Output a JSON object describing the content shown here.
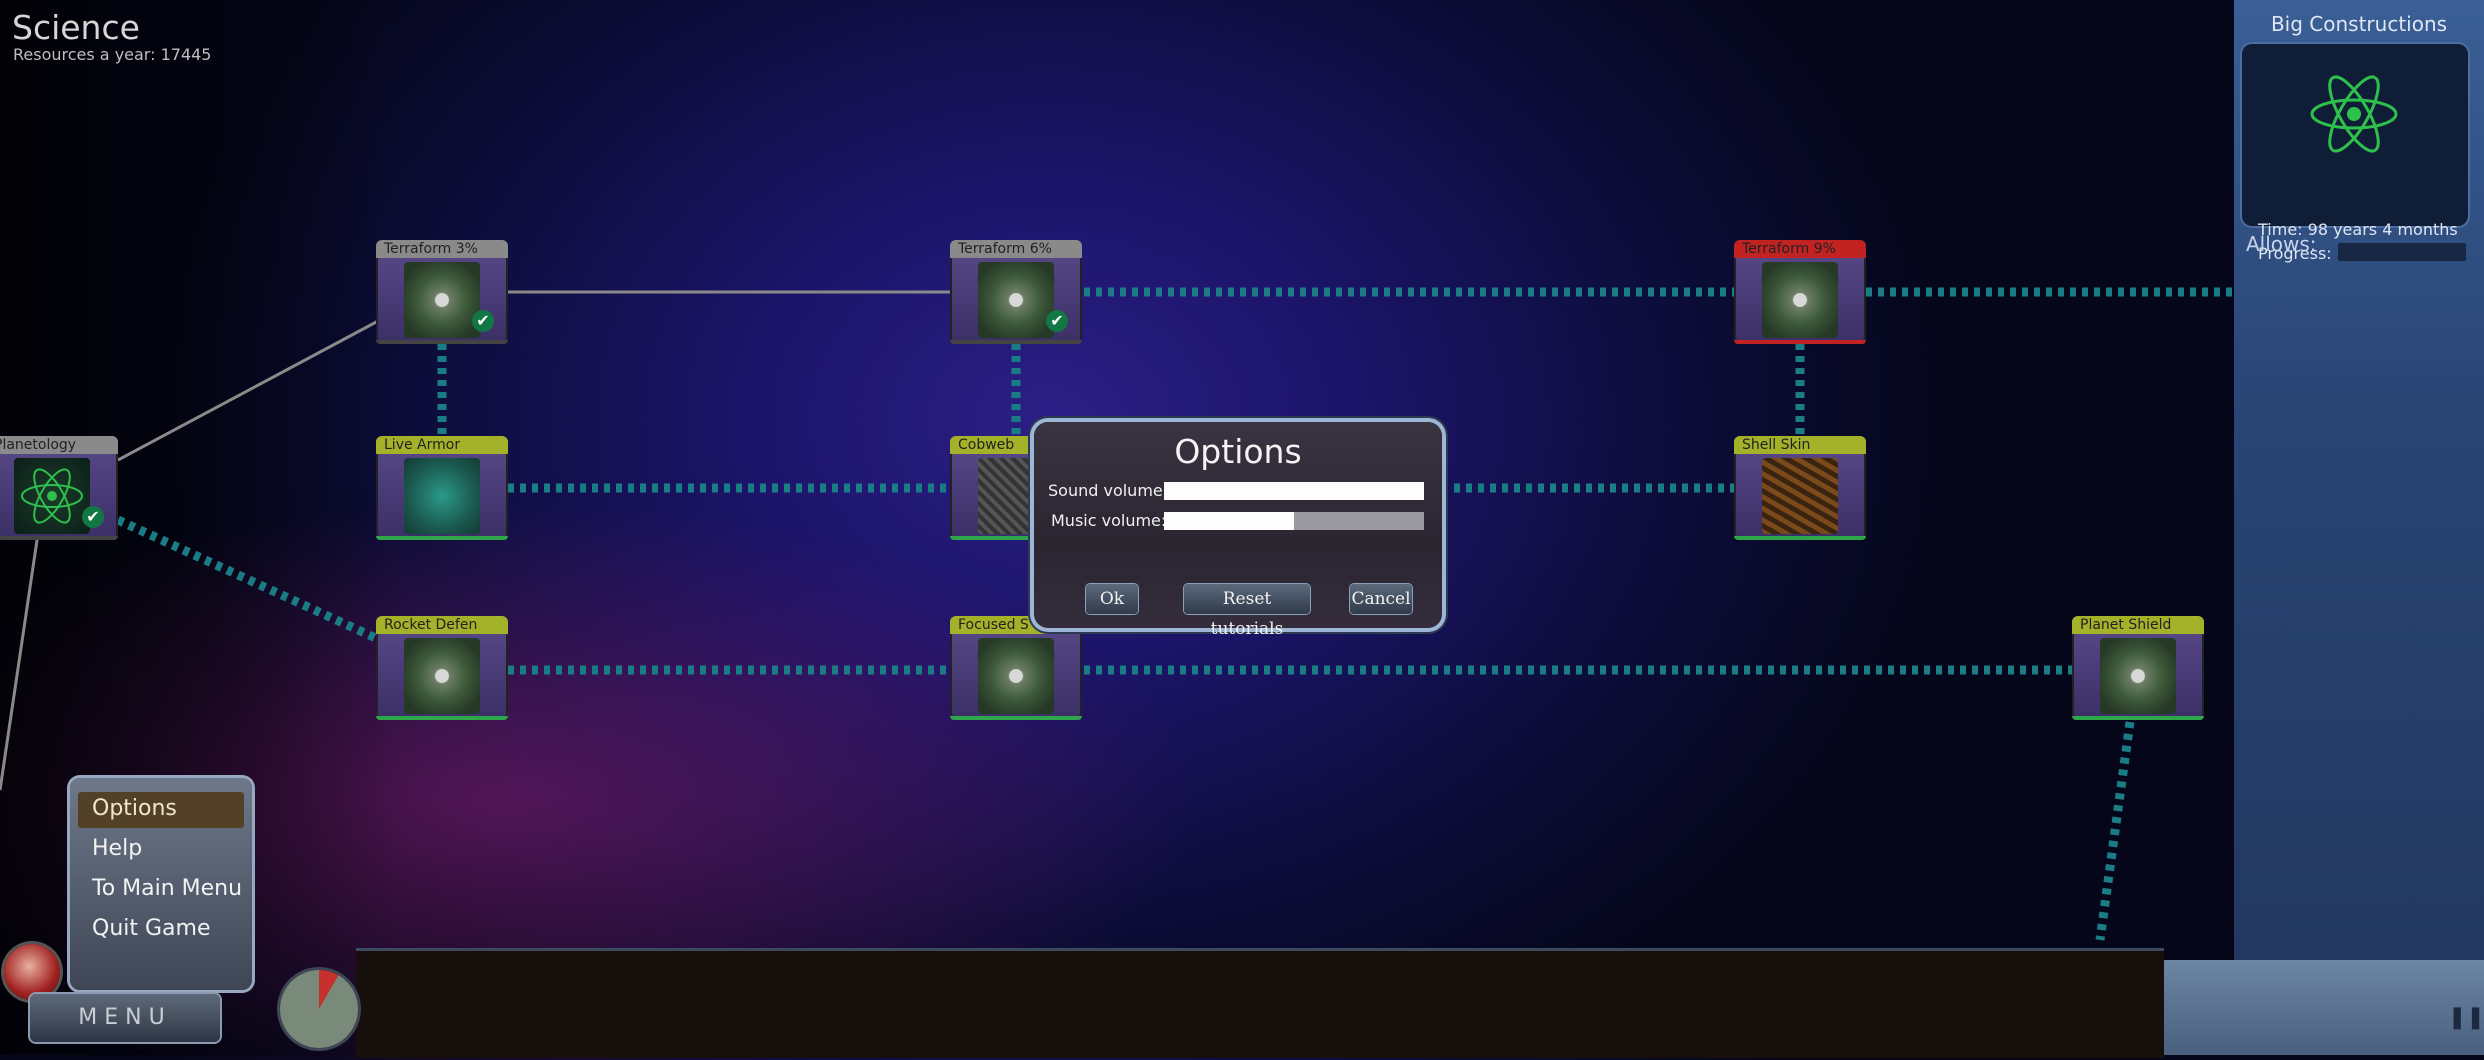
{
  "header": {
    "title": "Science",
    "resources": "Resources a year: 17445"
  },
  "nodes": [
    {
      "id": "terraform-3",
      "label": "Terraform 3%",
      "researched": true,
      "header_color": "#8a8a8a"
    },
    {
      "id": "terraform-6",
      "label": "Terraform 6%",
      "researched": true,
      "header_color": "#8a8a8a"
    },
    {
      "id": "terraform-9",
      "label": "Terraform 9%",
      "researched": false,
      "header_color": "#c22222"
    },
    {
      "id": "planetology",
      "label": "Planetology",
      "researched": true,
      "header_color": "#8a8a8a"
    },
    {
      "id": "live-armor",
      "label": "Live Armor",
      "researched": false,
      "header_color": "#a4b22a"
    },
    {
      "id": "cobweb",
      "label": "Cobweb",
      "researched": false,
      "header_color": "#a4b22a"
    },
    {
      "id": "shell-skin",
      "label": "Shell Skin",
      "researched": false,
      "header_color": "#a4b22a"
    },
    {
      "id": "rocket-defen",
      "label": "Rocket Defen",
      "researched": false,
      "header_color": "#a4b22a"
    },
    {
      "id": "focused",
      "label": "Focused S",
      "researched": false,
      "header_color": "#a4b22a"
    },
    {
      "id": "planet-shield",
      "label": "Planet Shield",
      "researched": false,
      "header_color": "#a4b22a"
    }
  ],
  "sidebar": {
    "title": "Big Constructions",
    "time_label": "Time:",
    "time_value": "98 years 4 months",
    "progress_label": "Progress:",
    "progress": 0,
    "allows_label": "Allows:"
  },
  "menu": {
    "items": [
      "Options",
      "Help",
      "To Main Menu",
      "Quit Game"
    ],
    "selected": "Options",
    "button_label": "MENU"
  },
  "options_dialog": {
    "title": "Options",
    "sound_label": "Sound volume:",
    "sound_value": 1.0,
    "music_label": "Music volume:",
    "music_value": 0.5,
    "ok_label": "Ok",
    "reset_label": "Reset tutorials",
    "cancel_label": "Cancel"
  },
  "colors": {
    "accent": "#9eb6d6",
    "link_teal": "#1a7d86",
    "researched_link": "#9a9a9a"
  }
}
